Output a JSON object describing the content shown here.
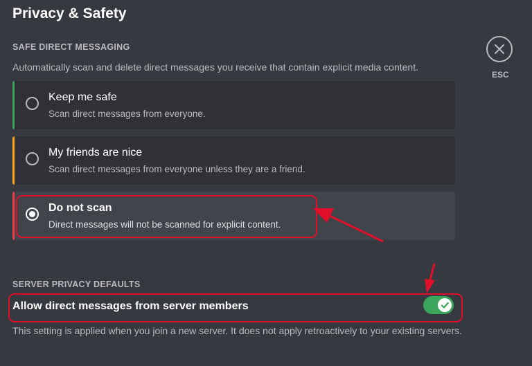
{
  "page": {
    "title": "Privacy & Safety"
  },
  "close": {
    "icon": "close-icon",
    "label": "ESC"
  },
  "safe_dm": {
    "label": "SAFE DIRECT MESSAGING",
    "description": "Automatically scan and delete direct messages you receive that contain explicit media content.",
    "options": [
      {
        "title": "Keep me safe",
        "description": "Scan direct messages from everyone.",
        "selected": false,
        "accent": "#3ba55c"
      },
      {
        "title": "My friends are nice",
        "description": "Scan direct messages from everyone unless they are a friend.",
        "selected": false,
        "accent": "#faa81a"
      },
      {
        "title": "Do not scan",
        "description": "Direct messages will not be scanned for explicit content.",
        "selected": true,
        "accent": "#ed4245"
      }
    ]
  },
  "server_privacy": {
    "label": "SERVER PRIVACY DEFAULTS",
    "toggle_label": "Allow direct messages from server members",
    "toggle_on": true,
    "help": "This setting is applied when you join a new server. It does not apply retroactively to your existing servers."
  },
  "colors": {
    "background": "#36393f",
    "card": "#2f3136",
    "toggle_on": "#3ba55c",
    "annotation": "#e0102a"
  }
}
